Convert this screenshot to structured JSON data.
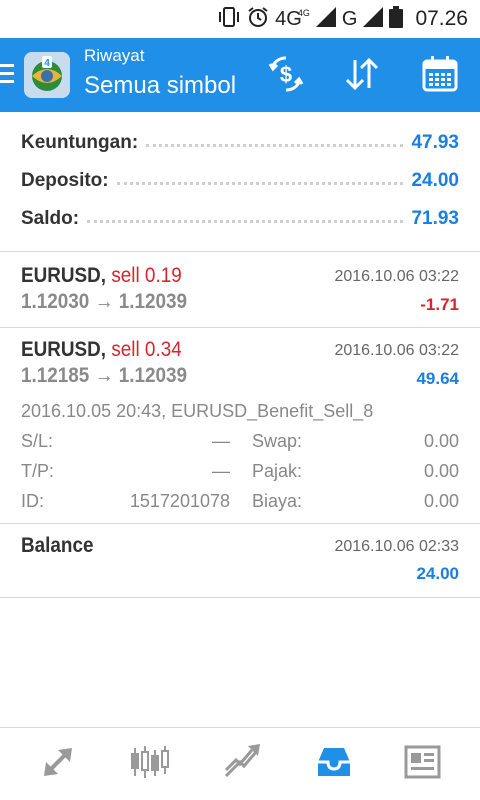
{
  "statusbar": {
    "network_1": "4G",
    "network_1_sup": "4G",
    "network_2": "G",
    "time": "07.26"
  },
  "appbar": {
    "title": "Riwayat",
    "subtitle": "Semua simbol",
    "accent": "#1f8fe8"
  },
  "summary": {
    "rows": [
      {
        "label": "Keuntungan:",
        "value": "47.93"
      },
      {
        "label": "Deposito:",
        "value": "24.00"
      },
      {
        "label": "Saldo:",
        "value": "71.93"
      }
    ]
  },
  "deals": [
    {
      "symbol": "EURUSD,",
      "type": "sell 0.19",
      "time": "2016.10.06 03:22",
      "prices": "1.12030 → 1.12039",
      "profit": "-1.71"
    },
    {
      "symbol": "EURUSD,",
      "type": "sell 0.34",
      "time": "2016.10.06 03:22",
      "prices": "1.12185 → 1.12039",
      "profit": "49.64",
      "details": {
        "open_line": "2016.10.05 20:43, EURUSD_Benefit_Sell_8",
        "sl_label": "S/L:",
        "sl_value": "—",
        "tp_label": "T/P:",
        "tp_value": "—",
        "id_label": "ID:",
        "id_value": "1517201078",
        "swap_label": "Swap:",
        "swap_value": "0.00",
        "tax_label": "Pajak:",
        "tax_value": "0.00",
        "fee_label": "Biaya:",
        "fee_value": "0.00"
      }
    },
    {
      "symbol": "Balance",
      "time": "2016.10.06 02:33",
      "profit": "24.00"
    }
  ],
  "bottomnav": {
    "items": [
      "quotes-icon",
      "chart-icon",
      "trade-icon",
      "history-icon",
      "news-icon"
    ],
    "active": "history-icon",
    "active_color": "#1f8fe8",
    "inactive_color": "#9a9a9a"
  },
  "colors": {
    "profit_positive": "#1a7fe0",
    "profit_negative": "#d7252d"
  }
}
